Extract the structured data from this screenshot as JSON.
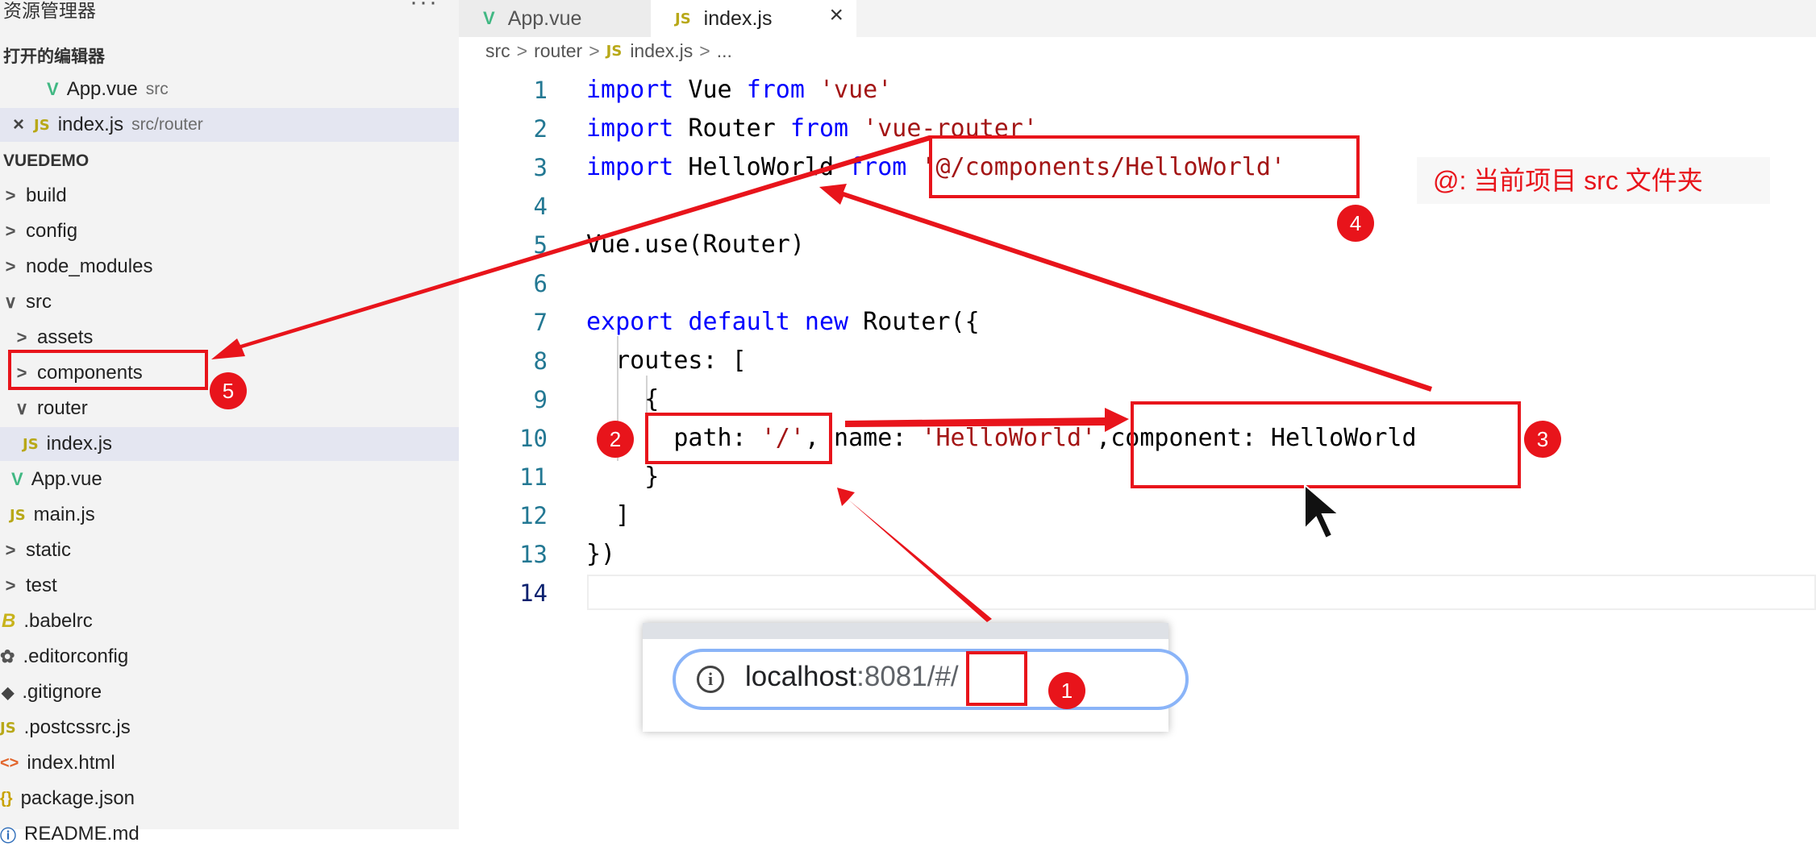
{
  "sidebar": {
    "title": "资源管理器",
    "more": "···",
    "open_editors_title": "打开的编辑器",
    "open_editors": [
      {
        "name": "App.vue",
        "path": "src",
        "icon": "vue-icon"
      },
      {
        "name": "index.js",
        "path": "src/router",
        "icon": "js-icon"
      }
    ],
    "project_title": "VUEDEMO",
    "tree": [
      {
        "name": "build",
        "icon": "chevron-right"
      },
      {
        "name": "config",
        "icon": "chevron-right"
      },
      {
        "name": "node_modules",
        "icon": "chevron-right"
      },
      {
        "name": "src",
        "icon": "chevron-down"
      },
      {
        "name": "assets",
        "icon": "chevron-right"
      },
      {
        "name": "components",
        "icon": "chevron-right"
      },
      {
        "name": "router",
        "icon": "chevron-down"
      },
      {
        "name": "index.js",
        "icon": "js-icon"
      },
      {
        "name": "App.vue",
        "icon": "vue-icon"
      },
      {
        "name": "main.js",
        "icon": "js-icon"
      },
      {
        "name": "static",
        "icon": "chevron-right"
      },
      {
        "name": "test",
        "icon": "chevron-right"
      },
      {
        "name": ".babelrc",
        "icon": "babel-icon"
      },
      {
        "name": ".editorconfig",
        "icon": "gear-icon"
      },
      {
        "name": ".gitignore",
        "icon": "git-icon"
      },
      {
        "name": ".postcssrc.js",
        "icon": "js-icon"
      },
      {
        "name": "index.html",
        "icon": "html-icon"
      },
      {
        "name": "package.json",
        "icon": "json-icon"
      },
      {
        "name": "README.md",
        "icon": "info-icon"
      }
    ]
  },
  "tabs": [
    {
      "label": "App.vue",
      "icon": "vue-icon",
      "active": false
    },
    {
      "label": "index.js",
      "icon": "js-icon",
      "active": true,
      "close": "×"
    }
  ],
  "breadcrumb": [
    "src",
    "router",
    "index.js",
    "..."
  ],
  "icons": {
    "vue": "V",
    "js": "JS",
    "babel": "B",
    "gear": "✿",
    "git": "◆",
    "html": "<>",
    "json": "{}",
    "readme": "ⓘ",
    "chevron_right": ">",
    "chevron_down": "∨",
    "close": "×"
  },
  "code": {
    "line_numbers": [
      "1",
      "2",
      "3",
      "4",
      "5",
      "6",
      "7",
      "8",
      "9",
      "10",
      "11",
      "12",
      "13",
      "14"
    ],
    "l1": {
      "kw1": "import",
      "id": " Vue ",
      "kw2": "from",
      "str": " 'vue'"
    },
    "l2": {
      "kw1": "import",
      "id": " Router ",
      "kw2": "from",
      "str": " 'vue-router'"
    },
    "l3": {
      "kw1": "import",
      "id": " HelloWorld ",
      "kw2": "from",
      "str": " '@/components/HelloWorld'"
    },
    "l5": "Vue.use(Router)",
    "l7": {
      "kw1": "export",
      "kw2": " default",
      "kw3": " new",
      "rest": " Router({"
    },
    "l8": "  routes: [",
    "l9": "    {",
    "l10": {
      "a": "      path: ",
      "s1": "'/'",
      "b": ", name: ",
      "s2": "'HelloWorld'",
      "c": ",component: HelloWorld"
    },
    "l11": "    }",
    "l12": "  ]",
    "l13": "})"
  },
  "browser": {
    "info": "i",
    "host": "localhost",
    "rest": ":8081/#/"
  },
  "annotations": {
    "badges": [
      "1",
      "2",
      "3",
      "4",
      "5"
    ],
    "note": "@:  当前项目 src 文件夹"
  },
  "colors": {
    "annotation_red": "#e8141b",
    "keyword": "#0000ff",
    "string": "#a31515",
    "line_number": "#237893"
  }
}
